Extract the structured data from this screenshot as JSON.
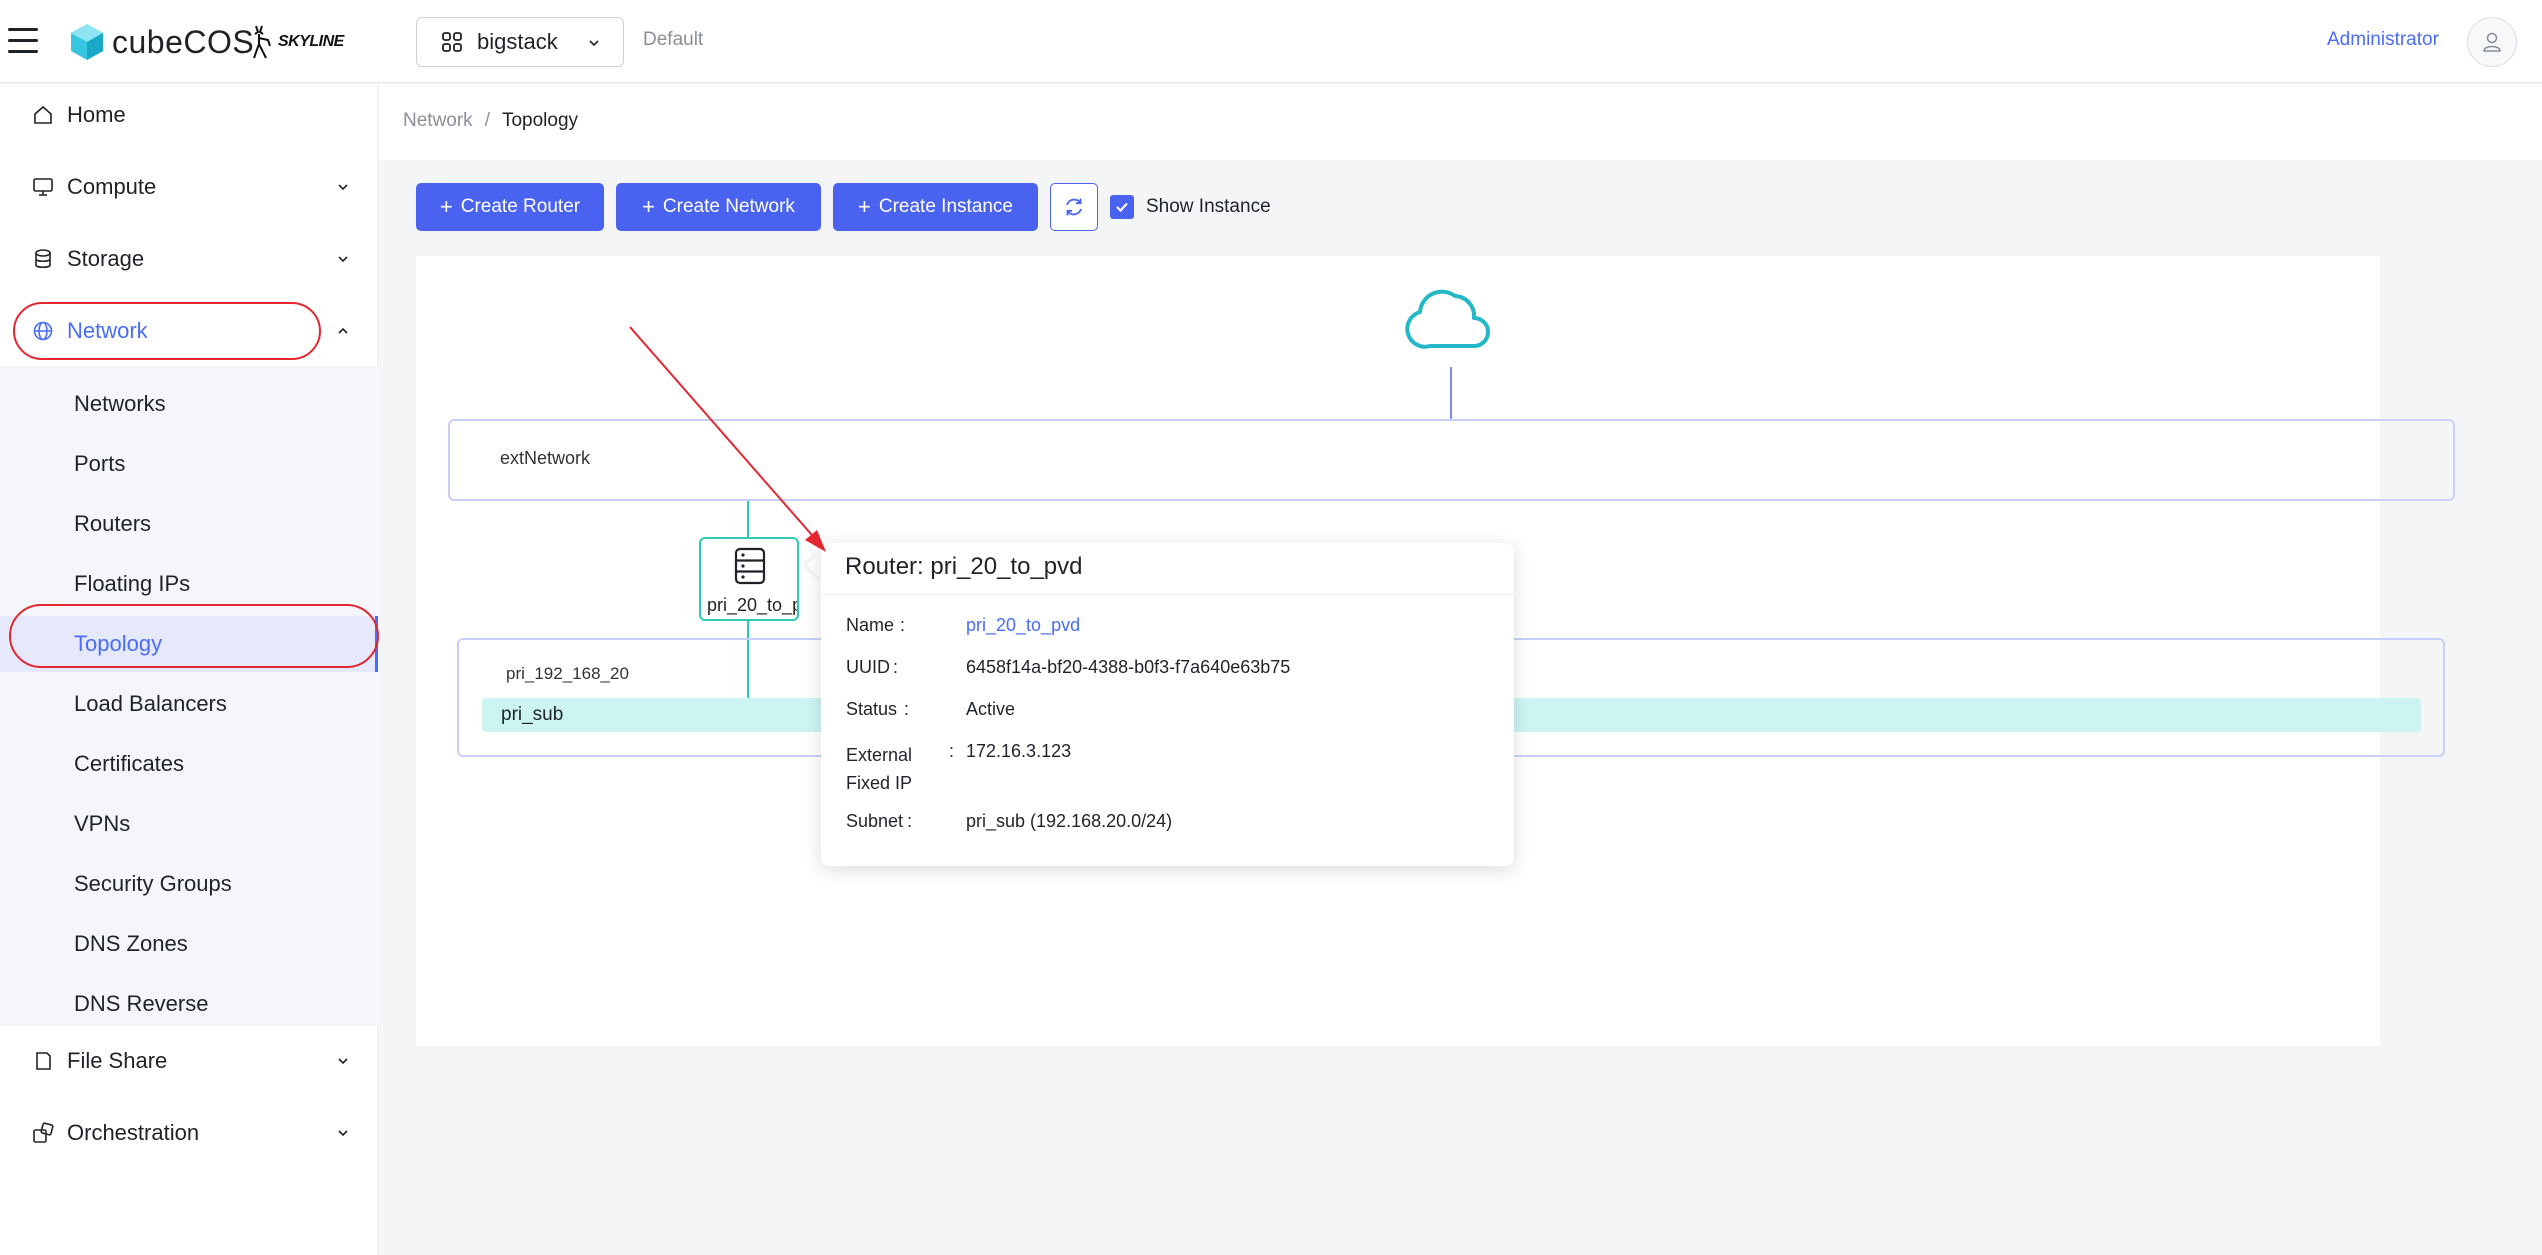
{
  "header": {
    "brand": "cubeCOS",
    "partner_logo": "SKYLINE",
    "project": "bigstack",
    "domain": "Default",
    "user": "Administrator"
  },
  "sidebar": {
    "items": [
      {
        "label": "Home",
        "icon": "home-icon"
      },
      {
        "label": "Compute",
        "icon": "monitor-icon"
      },
      {
        "label": "Storage",
        "icon": "database-icon"
      },
      {
        "label": "Network",
        "icon": "globe-icon"
      },
      {
        "label": "File Share",
        "icon": "file-icon"
      },
      {
        "label": "Orchestration",
        "icon": "orchestration-icon"
      }
    ],
    "network_submenu": [
      "Networks",
      "Ports",
      "Routers",
      "Floating IPs",
      "Topology",
      "Load Balancers",
      "Certificates",
      "VPNs",
      "Security Groups",
      "DNS Zones",
      "DNS Reverse"
    ],
    "selected_submenu": "Topology"
  },
  "breadcrumb": {
    "parent": "Network",
    "separator": "/",
    "current": "Topology"
  },
  "toolbar": {
    "create_router": "Create Router",
    "create_network": "Create Network",
    "create_instance": "Create Instance",
    "show_instance": "Show Instance",
    "show_instance_checked": true
  },
  "topology": {
    "external_network": "extNetwork",
    "network": "pri_192_168_20",
    "subnet": "pri_sub",
    "router_node_label": "pri_20_to_p"
  },
  "popover": {
    "title": "Router: pri_20_to_pvd",
    "fields": [
      {
        "key": "Name",
        "value": "pri_20_to_pvd"
      },
      {
        "key": "UUID",
        "value": "6458f14a-bf20-4388-b0f3-f7a640e63b75"
      },
      {
        "key": "Status",
        "value": "Active"
      },
      {
        "key": "External\nFixed IP",
        "value": "172.16.3.123"
      },
      {
        "key": "Subnet",
        "value": "pri_sub (192.168.20.0/24)"
      }
    ]
  },
  "colors": {
    "primary": "#4a62f0",
    "teal": "#2ec9b7",
    "annotation_red": "#e3262f"
  }
}
